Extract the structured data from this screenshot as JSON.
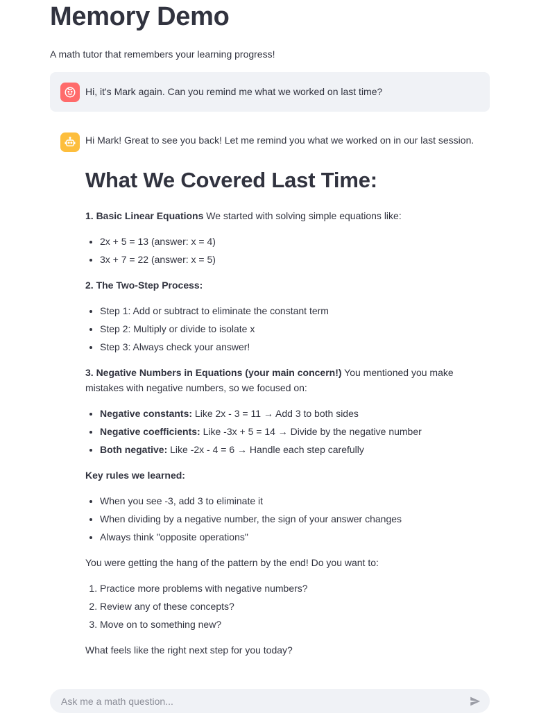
{
  "header": {
    "title": "Memory Demo",
    "subtitle": "A math tutor that remembers your learning progress!"
  },
  "colors": {
    "user_avatar": "#ff6b6b",
    "bot_avatar": "#fdbe3d",
    "message_bg": "#f0f2f6",
    "text": "#31333f"
  },
  "user_message": {
    "avatar_icon": "user-face-icon",
    "text": "Hi, it's Mark again. Can you remind me what we worked on last time?"
  },
  "assistant_message": {
    "avatar_icon": "robot-icon",
    "intro": "Hi Mark! Great to see you back! Let me remind you what we worked on in our last session.",
    "heading": "What We Covered Last Time:",
    "section1_title": "1. Basic Linear Equations",
    "section1_text": " We started with solving simple equations like:",
    "section1_items": [
      "2x + 5 = 13 (answer: x = 4)",
      "3x + 7 = 22 (answer: x = 5)"
    ],
    "section2_title": "2. The Two-Step Process:",
    "section2_items": [
      "Step 1: Add or subtract to eliminate the constant term",
      "Step 2: Multiply or divide to isolate x",
      "Step 3: Always check your answer!"
    ],
    "section3_title": "3. Negative Numbers in Equations (your main concern!)",
    "section3_text": " You mentioned you make mistakes with negative numbers, so we focused on:",
    "section3_items": [
      {
        "label": "Negative constants:",
        "text": " Like 2x - 3 = 11 → Add 3 to both sides"
      },
      {
        "label": "Negative coefficients:",
        "text": " Like -3x + 5 = 14 → Divide by the negative number"
      },
      {
        "label": "Both negative:",
        "text": " Like -2x - 4 = 6 → Handle each step carefully"
      }
    ],
    "rules_title": "Key rules we learned:",
    "rules_items": [
      "When you see -3, add 3 to eliminate it",
      "When dividing by a negative number, the sign of your answer changes",
      "Always think \"opposite operations\""
    ],
    "options_intro": "You were getting the hang of the pattern by the end! Do you want to:",
    "options_items": [
      "Practice more problems with negative numbers?",
      "Review any of these concepts?",
      "Move on to something new?"
    ],
    "closing": "What feels like the right next step for you today?"
  },
  "chat_input": {
    "placeholder": "Ask me a math question...",
    "value": "",
    "send_icon": "send-icon"
  }
}
